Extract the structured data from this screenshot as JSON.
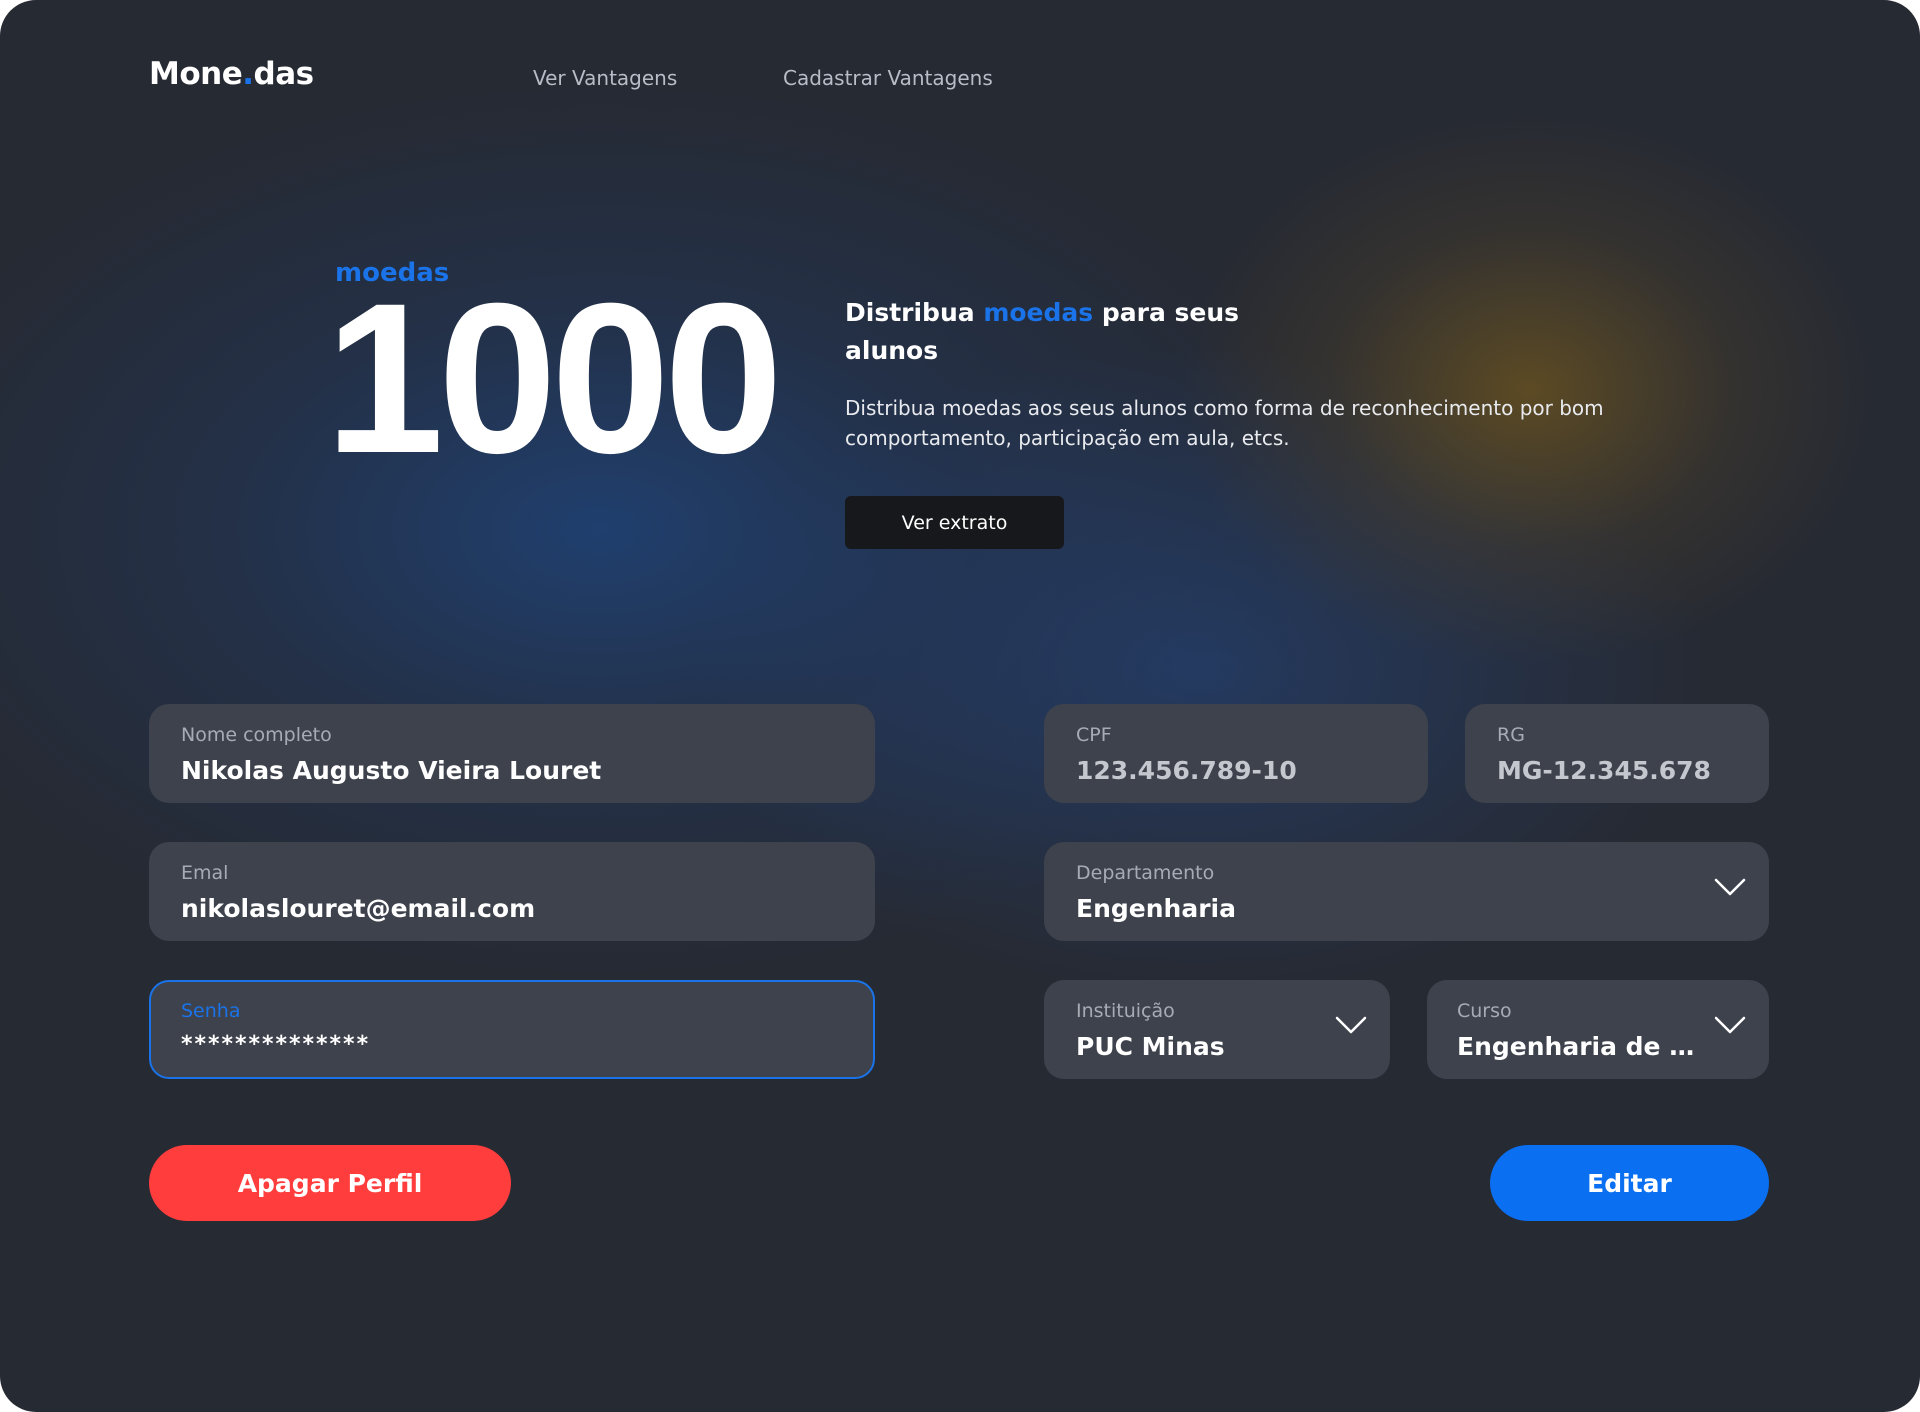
{
  "header": {
    "logo_part1": "Mone",
    "logo_dot": ".",
    "logo_part2": "das",
    "nav": [
      {
        "label": "Ver Vantagens"
      },
      {
        "label": "Cadastrar Vantagens"
      }
    ]
  },
  "hero": {
    "coins_label": "moedas",
    "coins_value": "1000",
    "title_part1": "Distribua ",
    "title_accent": "moedas",
    "title_part2": " para seus alunos",
    "description": "Distribua moedas aos seus alunos como forma de reconhecimento por bom comportamento, participação em aula, etcs.",
    "extract_button": "Ver extrato"
  },
  "form": {
    "name": {
      "label": "Nome completo",
      "value": "Nikolas Augusto Vieira Louret"
    },
    "cpf": {
      "label": "CPF",
      "value": "123.456.789-10"
    },
    "rg": {
      "label": "RG",
      "value": "MG-12.345.678"
    },
    "email": {
      "label": "Emal",
      "value": "nikolaslouret@email.com"
    },
    "department": {
      "label": "Departamento",
      "value": "Engenharia"
    },
    "password": {
      "label": "Senha",
      "value": "**************"
    },
    "institution": {
      "label": "Instituição",
      "value": "PUC Minas"
    },
    "course": {
      "label": "Curso",
      "value": "Engenharia de S..."
    }
  },
  "actions": {
    "delete_label": "Apagar Perfil",
    "edit_label": "Editar"
  },
  "colors": {
    "accent": "#1a73e8",
    "danger": "#ff3d3d",
    "primary_button": "#0a6ff0",
    "background": "#262a33",
    "field": "#3e424c"
  }
}
